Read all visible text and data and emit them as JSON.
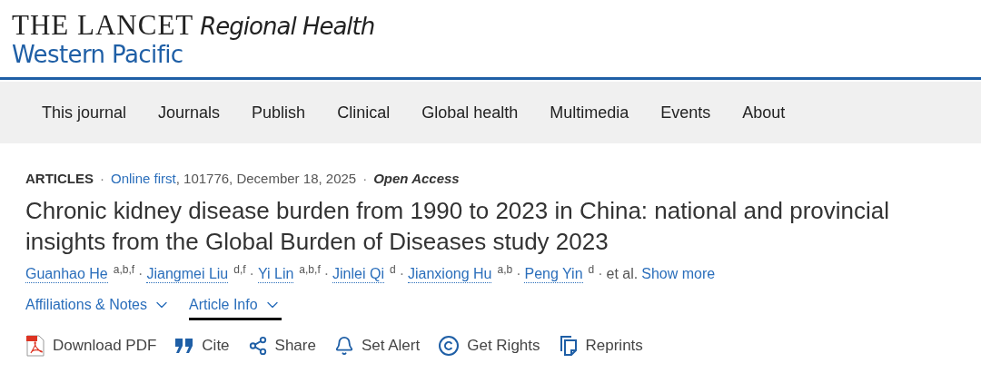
{
  "journal": {
    "name": "THE LANCET",
    "series": "Regional Health",
    "region": "Western Pacific"
  },
  "nav": [
    "This journal",
    "Journals",
    "Publish",
    "Clinical",
    "Global health",
    "Multimedia",
    "Events",
    "About"
  ],
  "meta": {
    "section": "ARTICLES",
    "status": "Online first",
    "details": ", 101776, December 18, 2025",
    "access": "Open Access"
  },
  "title": "Chronic kidney disease burden from 1990 to 2023 in China: national and provincial insights from the Global Burden of Diseases study 2023",
  "authors": [
    {
      "name": "Guanhao He",
      "affiliations": "a,b,f"
    },
    {
      "name": "Jiangmei Liu",
      "affiliations": "d,f"
    },
    {
      "name": "Yi Lin",
      "affiliations": "a,b,f"
    },
    {
      "name": "Jinlei Qi",
      "affiliations": "d"
    },
    {
      "name": "Jianxiong Hu",
      "affiliations": "a,b"
    },
    {
      "name": "Peng Yin",
      "affiliations": "d"
    }
  ],
  "separator": "·",
  "et_al": "et al.",
  "show_more": "Show more",
  "tabs": [
    {
      "label": "Affiliations & Notes",
      "selected": false
    },
    {
      "label": "Article Info",
      "selected": true
    }
  ],
  "actions": [
    {
      "label": "Download PDF",
      "kind": "pdf"
    },
    {
      "label": "Cite",
      "kind": "cite"
    },
    {
      "label": "Share",
      "kind": "share"
    },
    {
      "label": "Set Alert",
      "kind": "alert"
    },
    {
      "label": "Get Rights",
      "kind": "rights"
    },
    {
      "label": "Reprints",
      "kind": "reprints"
    }
  ]
}
